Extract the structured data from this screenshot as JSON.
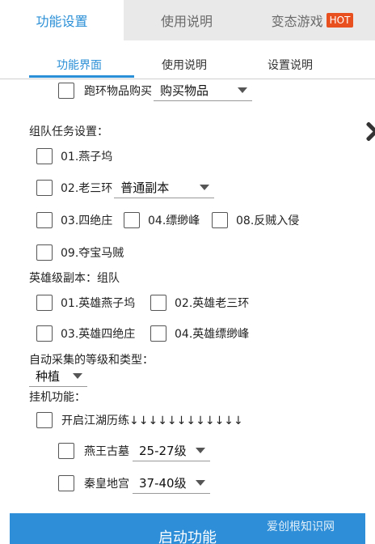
{
  "top_tabs": {
    "tab1": "功能设置",
    "tab2": "使用说明",
    "tab3": "变态游戏",
    "hot_badge": "HOT"
  },
  "sub_tabs": {
    "tab1": "功能界面",
    "tab2": "使用说明",
    "tab3": "设置说明"
  },
  "ring": {
    "label": "跑环物品购买",
    "select_value": "购买物品"
  },
  "team": {
    "heading": "组队任务设置：",
    "opt01": "01.燕子坞",
    "opt02": "02.老三环",
    "opt02_select": "普通副本",
    "opt03": "03.四绝庄",
    "opt04": "04.缥缈峰",
    "opt08": "08.反贼入侵",
    "opt09": "09.夺宝马贼"
  },
  "hero": {
    "heading": "英雄级副本：组队",
    "opt01": "01.英雄燕子坞",
    "opt02": "02.英雄老三环",
    "opt03": "03.英雄四绝庄",
    "opt04": "04.英雄缥缈峰"
  },
  "gather": {
    "heading": "自动采集的等级和类型：",
    "select_value": "种植"
  },
  "idle": {
    "heading": "挂机功能：",
    "jianghu_label": "开启江湖历练↓↓↓↓↓↓↓↓↓↓↓↓",
    "yanwang_label": "燕王古墓",
    "yanwang_select": "25-27级",
    "qinhuang_label": "秦皇地宫",
    "qinhuang_select": "37-40级"
  },
  "start_button": "启动功能",
  "watermark": "爱创根知识网"
}
